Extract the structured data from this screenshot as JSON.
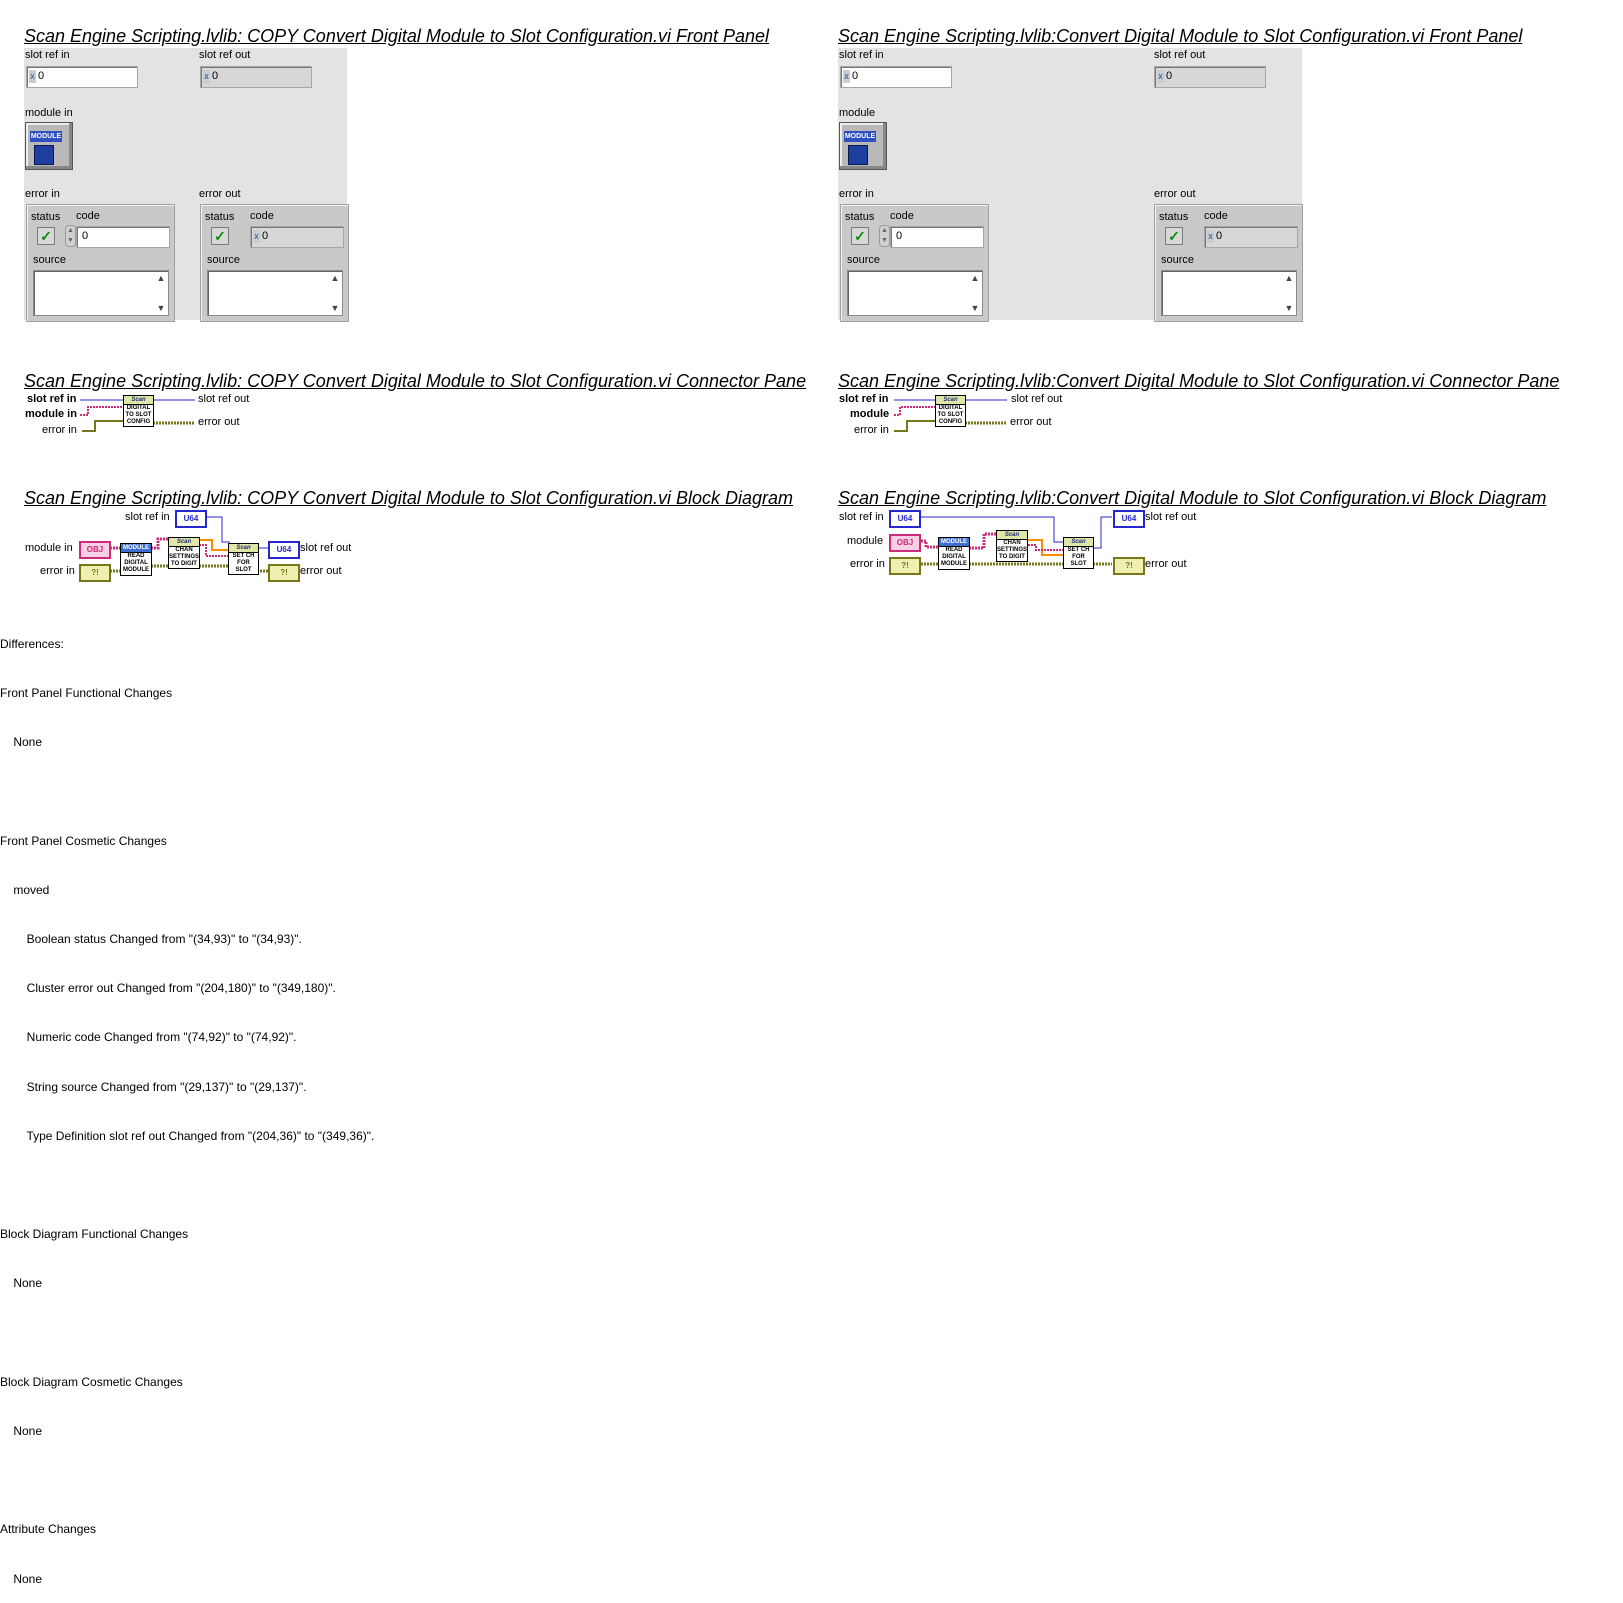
{
  "left": {
    "fp_title": "Scan Engine Scripting.lvlib:  COPY  Convert Digital Module to Slot Configuration.vi Front Panel",
    "cp_title": "Scan Engine Scripting.lvlib:  COPY  Convert Digital Module to Slot Configuration.vi Connector Pane",
    "bd_title": "Scan Engine Scripting.lvlib:  COPY  Convert Digital Module to Slot Configuration.vi Block Diagram",
    "slot_ref_in": "slot ref in",
    "slot_ref_out": "slot ref out",
    "module_label": "module in",
    "error_in": "error in",
    "error_out": "error out",
    "status": "status",
    "code": "code",
    "source": "source",
    "value": "0",
    "module_tag": "MODULE",
    "cp_slot_ref_in": "slot ref in",
    "cp_module": "module in",
    "cp_error_in": "error in",
    "cp_slot_ref_out": "slot ref out",
    "cp_error_out": "error out",
    "cp_icon_text": "DIGITAL TO SLOT CONFIG",
    "bd_slot_ref_in": "slot ref in",
    "bd_module": "module in",
    "bd_error_in": "error in",
    "bd_slot_ref_out": "slot ref out",
    "bd_error_out": "error out"
  },
  "right": {
    "fp_title": "Scan Engine Scripting.lvlib:Convert Digital Module to Slot Configuration.vi Front Panel",
    "cp_title": "Scan Engine Scripting.lvlib:Convert Digital Module to Slot Configuration.vi Connector Pane",
    "bd_title": "Scan Engine Scripting.lvlib:Convert Digital Module to Slot Configuration.vi Block Diagram",
    "slot_ref_in": "slot ref in",
    "slot_ref_out": "slot ref out",
    "module_label": "module",
    "error_in": "error in",
    "error_out": "error out",
    "status": "status",
    "code": "code",
    "source": "source",
    "value": "0",
    "module_tag": "MODULE",
    "cp_slot_ref_in": "slot ref in",
    "cp_module": "module",
    "cp_error_in": "error in",
    "cp_slot_ref_out": "slot ref out",
    "cp_error_out": "error out",
    "cp_icon_text": "DIGITAL TO SLOT CONFIG",
    "bd_slot_ref_in": "slot ref in",
    "bd_module": "module",
    "bd_error_in": "error in",
    "bd_slot_ref_out": "slot ref out",
    "bd_error_out": "error out"
  },
  "diagram_nodes": {
    "u64": "U64",
    "obj": "OBJ",
    "err": "?!",
    "scan": "Scan",
    "module": "MODULE",
    "read": "READ DIGITAL MODULE",
    "chan": "CHAN SETTINGS TO DIGIT",
    "set": "SET CH FOR SLOT"
  },
  "differences": [
    "Differences:",
    "Front Panel Functional Changes",
    "    None",
    "",
    "Front Panel Cosmetic Changes",
    "    moved",
    "        Boolean status Changed from \"(34,93)\" to \"(34,93)\".",
    "        Cluster error out Changed from \"(204,180)\" to \"(349,180)\".",
    "        Numeric code Changed from \"(74,92)\" to \"(74,92)\".",
    "        String source Changed from \"(29,137)\" to \"(29,137)\".",
    "        Type Definition slot ref out Changed from \"(204,36)\" to \"(349,36)\".",
    "",
    "Block Diagram Functional Changes",
    "    None",
    "",
    "Block Diagram Cosmetic Changes",
    "    None",
    "",
    "Attribute Changes",
    "    None"
  ],
  "colors": {
    "panel_bg": "#e3e3e3",
    "u64_wire": "#2727d0",
    "obj_wire": "#cc2a7a",
    "error_wire": "#76761a",
    "orange_wire": "#ff8c00",
    "status_ok": "#0a8a0a"
  }
}
